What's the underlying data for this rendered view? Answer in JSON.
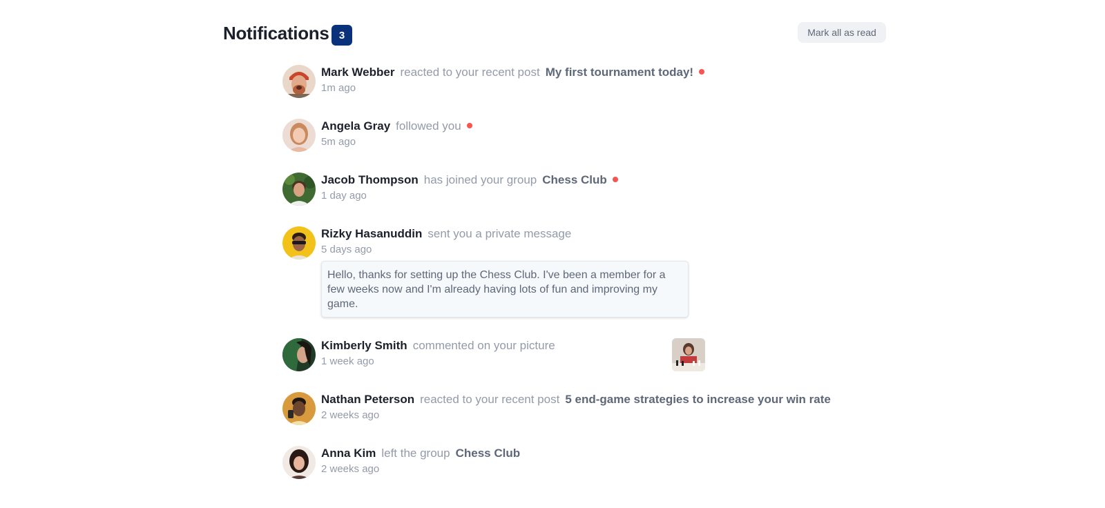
{
  "header": {
    "title": "Notifications",
    "unread_count": "3",
    "mark_all_label": "Mark all as read"
  },
  "notifications": [
    {
      "name": "Mark Webber",
      "action": "reacted to your recent post",
      "target": "My first tournament today!",
      "time": "1m ago",
      "unread": true,
      "avatar_icon": "avatar-mark-webber"
    },
    {
      "name": "Angela Gray",
      "action": "followed you",
      "time": "5m ago",
      "unread": true,
      "avatar_icon": "avatar-angela-gray"
    },
    {
      "name": "Jacob Thompson",
      "action": "has joined your group",
      "target": "Chess Club",
      "time": "1 day ago",
      "unread": true,
      "avatar_icon": "avatar-jacob-thompson"
    },
    {
      "name": "Rizky Hasanuddin",
      "action": "sent you a private message",
      "time": "5 days ago",
      "unread": false,
      "message": "Hello, thanks for setting up the Chess Club. I've been a member for a few weeks now and I'm already having lots of fun and improving my game.",
      "avatar_icon": "avatar-rizky-hasanuddin"
    },
    {
      "name": "Kimberly Smith",
      "action": "commented on your picture",
      "time": "1 week ago",
      "unread": false,
      "picture_icon": "chess-picture-thumbnail",
      "avatar_icon": "avatar-kimberly-smith"
    },
    {
      "name": "Nathan Peterson",
      "action": "reacted to your recent post",
      "target": "5 end-game strategies to increase your win rate",
      "time": "2 weeks ago",
      "unread": false,
      "avatar_icon": "avatar-nathan-peterson"
    },
    {
      "name": "Anna Kim",
      "action": "left the group",
      "target": "Chess Club",
      "time": "2 weeks ago",
      "unread": false,
      "avatar_icon": "avatar-anna-kim"
    }
  ],
  "colors": {
    "badge": "#0a327b",
    "unread_dot": "#f65552",
    "name": "#1c202b",
    "muted": "#939aa8",
    "target": "#5e6778",
    "message_bg": "#f6f9fb"
  }
}
